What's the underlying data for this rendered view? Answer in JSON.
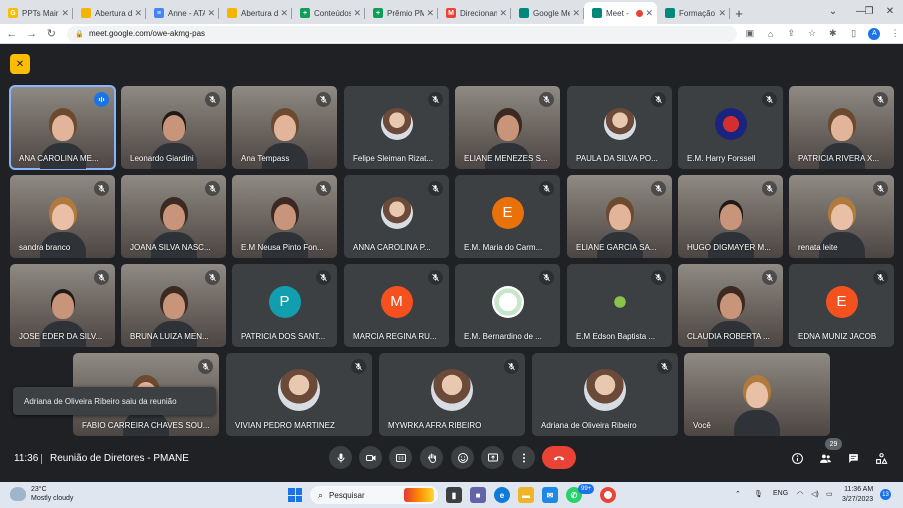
{
  "browser": {
    "tabs": [
      {
        "label": "PPTs Mairin",
        "color": "#fbbc04",
        "glyph": "G"
      },
      {
        "label": "Abertura d",
        "color": "#f4b400",
        "glyph": ""
      },
      {
        "label": "Anne - ATA",
        "color": "#4285f4",
        "glyph": "≡"
      },
      {
        "label": "Abertura de",
        "color": "#f4b400",
        "glyph": ""
      },
      {
        "label": "Conteúdos",
        "color": "#0f9d58",
        "glyph": "+"
      },
      {
        "label": "Prêmio PM",
        "color": "#0f9d58",
        "glyph": "+"
      },
      {
        "label": "Direcionam",
        "color": "#ea4335",
        "glyph": "M"
      },
      {
        "label": "Google Me",
        "color": "#00897b",
        "glyph": ""
      },
      {
        "label": "Meet -",
        "color": "#00897b",
        "glyph": "",
        "active": true
      },
      {
        "label": "Formação",
        "color": "#00897b",
        "glyph": ""
      }
    ],
    "new_tab": "+",
    "window_controls": [
      "⌄",
      "—",
      "❐",
      "✕"
    ],
    "url": "meet.google.com/owe-akmg-pas",
    "profile_initial": "A"
  },
  "meet": {
    "participants": [
      {
        "name": "ANA CAROLINA ME...",
        "kind": "video",
        "speaking": true,
        "look": "light"
      },
      {
        "name": "Leonardo Giardini",
        "kind": "video",
        "look": "man"
      },
      {
        "name": "Ana Tempass",
        "kind": "video",
        "look": "light"
      },
      {
        "name": "Felipe Sleiman Rizat...",
        "kind": "photo"
      },
      {
        "name": "ELIANE MENEZES S...",
        "kind": "video",
        "look": "dark"
      },
      {
        "name": "PAULA DA SILVA PO...",
        "kind": "photo"
      },
      {
        "name": "E.M. Harry Forssell",
        "kind": "team"
      },
      {
        "name": "PATRICIA RIVERA X...",
        "kind": "video",
        "look": "light"
      },
      {
        "name": "sandra branco",
        "kind": "video",
        "look": "blond"
      },
      {
        "name": "JOANA SILVA NASC...",
        "kind": "video",
        "look": "dark"
      },
      {
        "name": "E.M Neusa Pinto Fon...",
        "kind": "video",
        "look": "dark"
      },
      {
        "name": "ANNA CAROLINA P...",
        "kind": "photo"
      },
      {
        "name": "E.M. Maria do Carm...",
        "kind": "letter",
        "letter": "E",
        "color": "#e8710a"
      },
      {
        "name": "ELIANE GARCIA SA...",
        "kind": "video",
        "look": "light"
      },
      {
        "name": "HUGO DIGMAYER M...",
        "kind": "video",
        "look": "man"
      },
      {
        "name": "renata leite",
        "kind": "video",
        "look": "blond"
      },
      {
        "name": "JOSE EDER DA SILV...",
        "kind": "video",
        "look": "man"
      },
      {
        "name": "BRUNA LUIZA MEN...",
        "kind": "video",
        "look": "dark"
      },
      {
        "name": "PATRICIA DOS SANT...",
        "kind": "letter",
        "letter": "P",
        "color": "#129eaf"
      },
      {
        "name": "MARCIA REGINA RU...",
        "kind": "letter",
        "letter": "M",
        "color": "#f4511e"
      },
      {
        "name": "E.M. Bernardino de ...",
        "kind": "logo"
      },
      {
        "name": "E.M Edson Baptista ...",
        "kind": "logo2"
      },
      {
        "name": "CLAUDIA ROBERTA ...",
        "kind": "video",
        "look": "dark"
      },
      {
        "name": "EDNA MUNIZ JACOB",
        "kind": "letter",
        "letter": "E",
        "color": "#f4511e"
      },
      {
        "name": "FABIO CARREIRA CHAVES SOU...",
        "kind": "video",
        "look": "light"
      },
      {
        "name": "VIVIAN PEDRO MARTINEZ",
        "kind": "photo"
      },
      {
        "name": "MYWRKA AFRA RIBEIRO",
        "kind": "photo"
      },
      {
        "name": "Adriana de Oliveira Ribeiro",
        "kind": "photo"
      },
      {
        "name": "Você",
        "kind": "self",
        "look": "blond"
      }
    ],
    "toast": "Adriana de Oliveira Ribeiro saiu da reunião",
    "time": "11:36",
    "title": "Reunião de Diretores - PMANE",
    "participant_count": "29"
  },
  "taskbar": {
    "temp": "23°C",
    "weather": "Mostly cloudy",
    "search_placeholder": "Pesquisar",
    "badge": "99+",
    "lang": "ENG",
    "clock_time": "11:36 AM",
    "clock_date": "3/27/2023",
    "notifications": "13"
  }
}
